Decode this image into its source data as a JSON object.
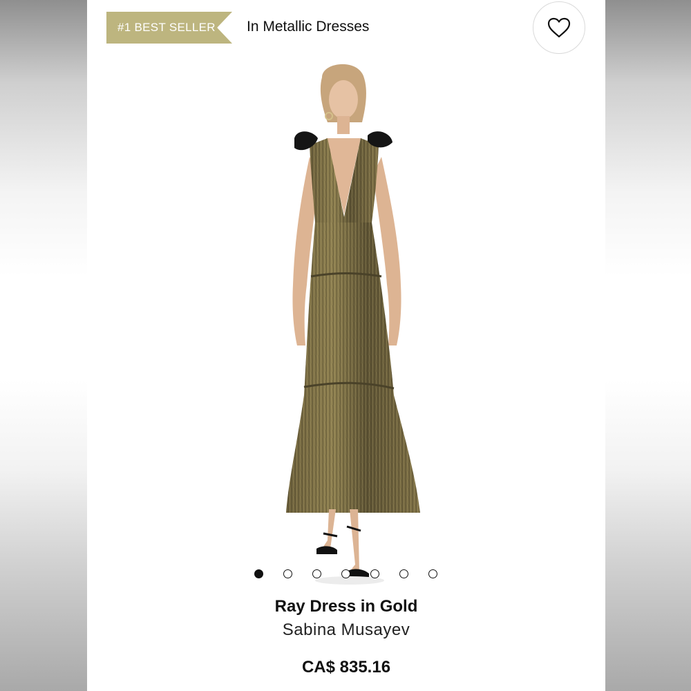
{
  "header": {
    "badge_label": "#1 BEST SELLER",
    "category_label": "In Metallic Dresses",
    "favorite_icon": "heart-icon"
  },
  "gallery": {
    "image_count": 7,
    "active_index": 0
  },
  "product": {
    "title": "Ray Dress in Gold",
    "brand": "Sabina Musayev",
    "price": "CA$ 835.16"
  },
  "colors": {
    "badge": "#bdb57f",
    "text": "#111111",
    "dress": "#7b6e45"
  }
}
